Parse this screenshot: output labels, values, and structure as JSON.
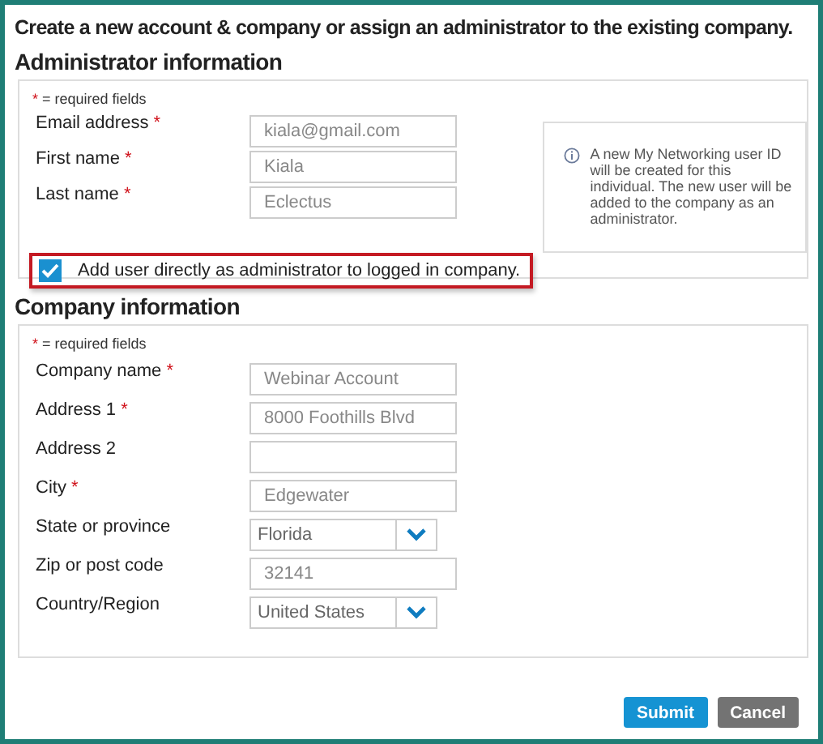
{
  "title": "Create a new account & company or assign an administrator to the existing company.",
  "sections": [
    {
      "heading": "Administrator information",
      "required_note": "= required fields",
      "required_mark": "*",
      "fields": [
        {
          "kind": "text",
          "label": "Email address",
          "required": true,
          "value": "kiala@gmail.com"
        },
        {
          "kind": "text",
          "label": "First name",
          "required": true,
          "value": "Kiala"
        },
        {
          "kind": "text",
          "label": "Last name",
          "required": true,
          "value": "Eclectus"
        }
      ],
      "checkbox": {
        "label": "Add user directly as administrator to logged in company.",
        "checked": true,
        "highlighted": true
      },
      "info": "A new My Networking user ID will be created for this individual. The new user will be added to the company as an administrator."
    },
    {
      "heading": "Company information",
      "required_note": "= required fields",
      "required_mark": "*",
      "fields": [
        {
          "kind": "text",
          "label": "Company name",
          "required": true,
          "value": "Webinar Account"
        },
        {
          "kind": "text",
          "label": "Address 1",
          "required": true,
          "value": "8000 Foothills Blvd"
        },
        {
          "kind": "text",
          "label": "Address 2",
          "required": false
        },
        {
          "kind": "text",
          "label": "City",
          "required": true,
          "value": "Edgewater"
        },
        {
          "kind": "select",
          "label": "State or province",
          "required": false,
          "value": "Florida"
        },
        {
          "kind": "text",
          "label": "Zip or post code",
          "required": false,
          "value": "32141"
        },
        {
          "kind": "select",
          "label": "Country/Region",
          "required": false,
          "value": "United States"
        }
      ]
    }
  ],
  "buttons": [
    {
      "label": "Submit",
      "kind": "primary"
    },
    {
      "label": "Cancel",
      "kind": "secondary"
    }
  ]
}
